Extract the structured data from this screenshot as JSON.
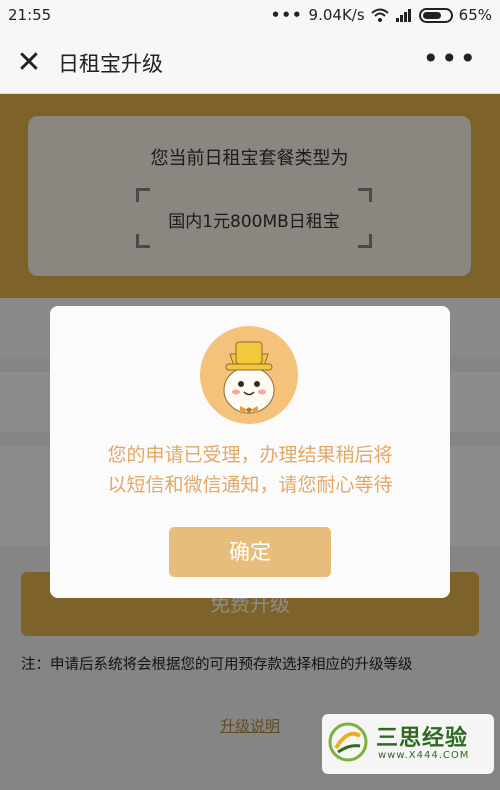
{
  "status_bar": {
    "time": "21:55",
    "network_speed": "9.04K/s",
    "battery": "65%"
  },
  "title_bar": {
    "title": "日租宝升级"
  },
  "card": {
    "title": "您当前日租宝套餐类型为",
    "plan_name": "国内1元800MB日租宝"
  },
  "actions": {
    "upgrade_label": "免费升级",
    "note": "注：申请后系统将会根据您的可用预存款选择相应的升级等级",
    "link_label": "升级说明"
  },
  "dialog": {
    "message_line1": "您的申请已受理，办理结果稍后将",
    "message_line2": "以短信和微信通知，请您耐心等待",
    "confirm_label": "确定"
  },
  "watermark": {
    "title": "三思经验",
    "url": "www.X444.COM"
  },
  "colors": {
    "accent": "#e3b54c",
    "dialog_text": "#e3a866",
    "confirm_button": "#e8bd7c"
  }
}
